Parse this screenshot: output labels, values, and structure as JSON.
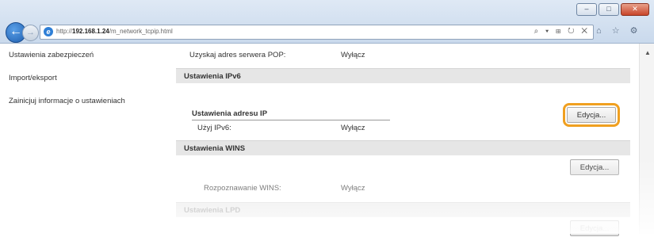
{
  "browser": {
    "url_prefix": "http://",
    "url_host": "192.168.1.24",
    "url_path": "/m_network_tcpip.html",
    "window_controls": [
      "–",
      "□",
      "✕"
    ],
    "address_tools": "⌕ ▾ ⊞ ↻ ✕",
    "right_tools": "⌂ ☆ ⚙"
  },
  "sidebar": {
    "items": [
      {
        "label": "Ustawienia zabezpieczeń"
      },
      {
        "label": "Import/eksport"
      },
      {
        "label": "Zainicjuj informacje o ustawieniach"
      }
    ]
  },
  "content": {
    "pop_row": {
      "label": "Uzyskaj adres serwera POP:",
      "value": "Wyłącz"
    },
    "ipv6_section": "Ustawienia IPv6",
    "edit_label": "Edycja...",
    "ip_sub_head": "Ustawienia adresu IP",
    "ipv6_row": {
      "label": "Użyj IPv6:",
      "value": "Wyłącz"
    },
    "wins_section": "Ustawienia WINS",
    "wins_row": {
      "label": "Rozpoznawanie WINS:",
      "value": "Wyłącz"
    },
    "lpd_section": "Ustawienia LPD"
  },
  "colors": {
    "highlight": "#f0a020",
    "section_bg": "#e6e6e6"
  }
}
